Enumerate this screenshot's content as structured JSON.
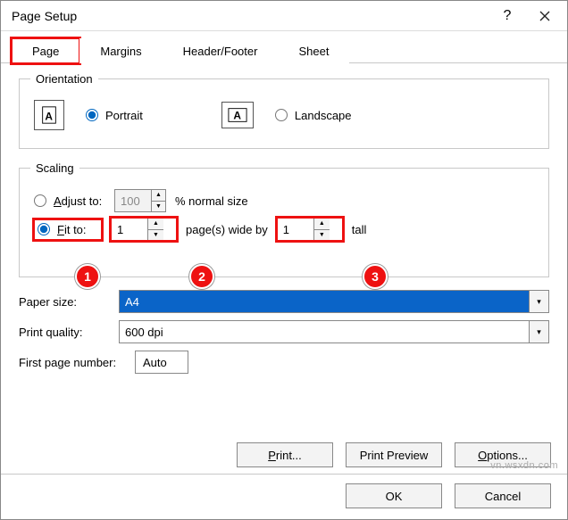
{
  "title": "Page Setup",
  "tabs": {
    "page": "Page",
    "margins": "Margins",
    "header": "Header/Footer",
    "sheet": "Sheet"
  },
  "orientation": {
    "legend": "Orientation",
    "portrait": "Portrait",
    "landscape": "Landscape"
  },
  "scaling": {
    "legend": "Scaling",
    "adjust_label_pre": "A",
    "adjust_label_post": "djust to:",
    "adjust_value": "100",
    "adjust_suffix": "% normal size",
    "fit_label_pre": "F",
    "fit_label_post": "it to:",
    "fit_wide": "1",
    "fit_mid": "page(s) wide by",
    "fit_tall": "1",
    "fit_suffix": "tall"
  },
  "paper": {
    "label": "Paper size:",
    "value": "A4"
  },
  "quality": {
    "label": "Print quality:",
    "value": "600 dpi"
  },
  "firstpage": {
    "label": "First page number:",
    "value": "Auto"
  },
  "buttons": {
    "print": "Print...",
    "preview": "Print Preview",
    "options": "Options...",
    "ok": "OK",
    "cancel": "Cancel"
  },
  "callouts": {
    "c1": "1",
    "c2": "2",
    "c3": "3"
  },
  "watermark": "vn.wsxdn.com"
}
